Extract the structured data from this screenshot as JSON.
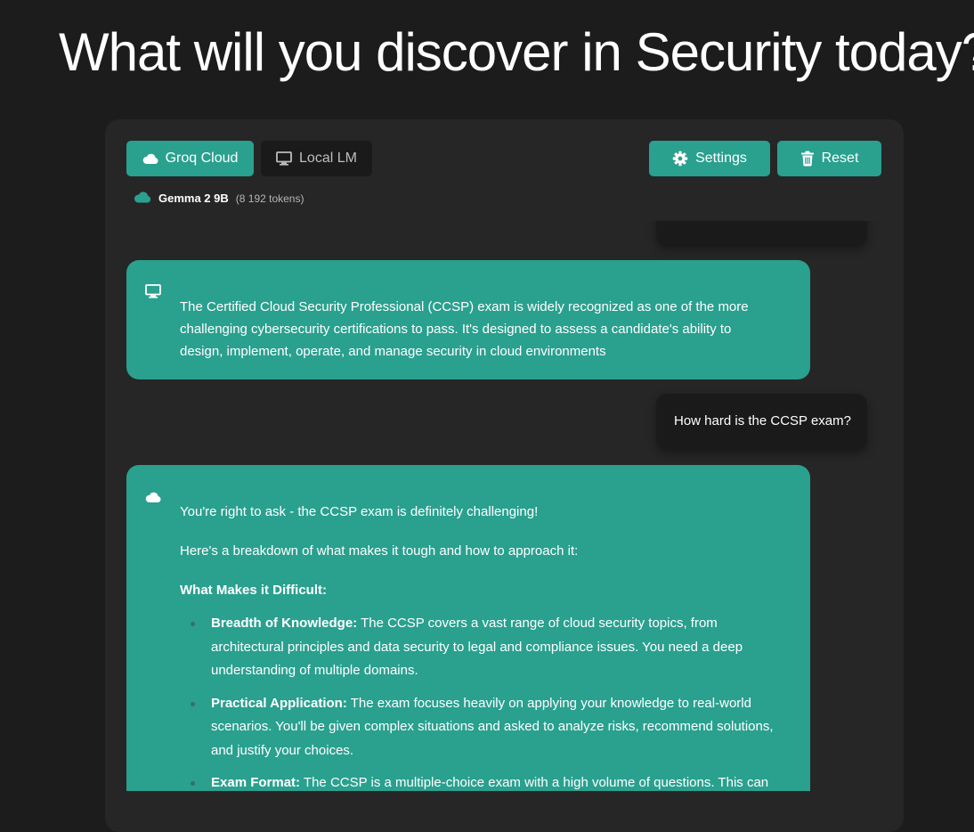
{
  "headline": "What will you discover in Security today?",
  "toolbar": {
    "groq_label": "Groq Cloud",
    "local_label": "Local LM",
    "settings_label": "Settings",
    "reset_label": "Reset"
  },
  "model": {
    "name": "Gemma 2 9B",
    "tokens": "(8 192 tokens)"
  },
  "messages": {
    "bot1": {
      "source_icon": "monitor-icon",
      "text": "The Certified Cloud Security Professional (CCSP) exam is widely recognized as one of the more challenging cybersecurity certifications to pass. It's designed to assess a candidate's ability to design, implement, operate, and manage security in cloud environments"
    },
    "user1": {
      "text": "How hard is the CCSP exam?"
    },
    "bot2": {
      "source_icon": "cloud-icon",
      "intro": "You're right to ask - the CCSP exam is definitely challenging!",
      "breakdown": "Here's a breakdown of what makes it tough and how to approach it:",
      "heading": "What Makes it Difficult:",
      "points": [
        {
          "title": "Breadth of Knowledge:",
          "body": " The CCSP covers a vast range of cloud security topics, from architectural principles and data security to legal and compliance issues. You need a deep understanding of multiple domains."
        },
        {
          "title": "Practical Application:",
          "body": " The exam focuses heavily on applying your knowledge to real-world scenarios. You'll be given complex situations and asked to analyze risks, recommend solutions, and justify your choices."
        },
        {
          "title": "Exam Format:",
          "body": " The CCSP is a multiple-choice exam with a high volume of questions. This can"
        }
      ]
    }
  },
  "colors": {
    "accent": "#2aa08f",
    "panel": "#262626",
    "background": "#1c1c1c"
  }
}
